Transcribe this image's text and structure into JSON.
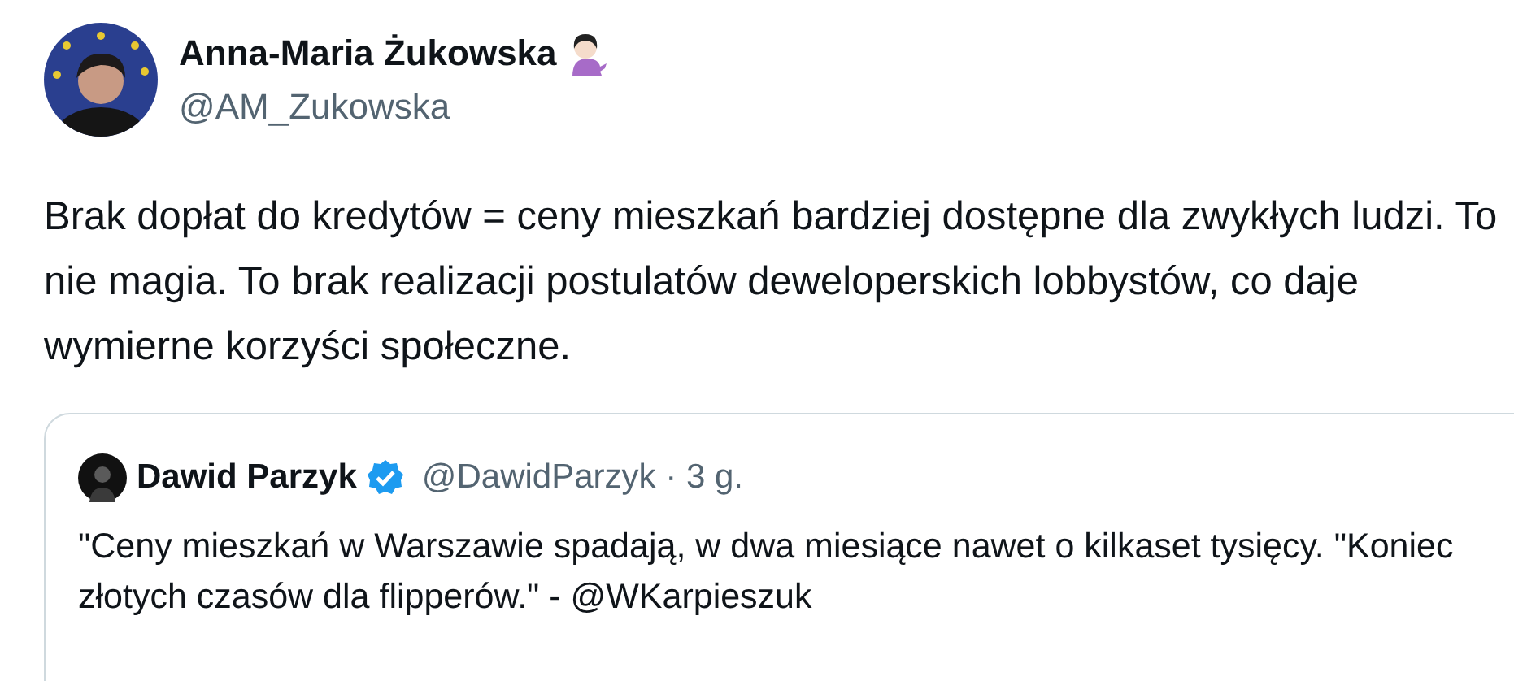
{
  "tweet": {
    "author": {
      "name": "Anna-Maria Żukowska",
      "handle": "@AM_Zukowska"
    },
    "text": "Brak dopłat do kredytów = ceny mieszkań bardziej dostępne dla zwykłych ludzi. To nie magia. To brak realizacji postulatów deweloperskich lobbystów, co daje wymierne korzyści społeczne.",
    "quote": {
      "author": {
        "name": "Dawid Parzyk",
        "handle": "@DawidParzyk",
        "verified": true
      },
      "separator": "·",
      "time": "3 g.",
      "text": "\"Ceny mieszkań w Warszawie spadają, w dwa miesiące nawet o kilkaset tysięcy. \"Koniec złotych czasów dla flipperów.\" - @WKarpieszuk"
    }
  }
}
